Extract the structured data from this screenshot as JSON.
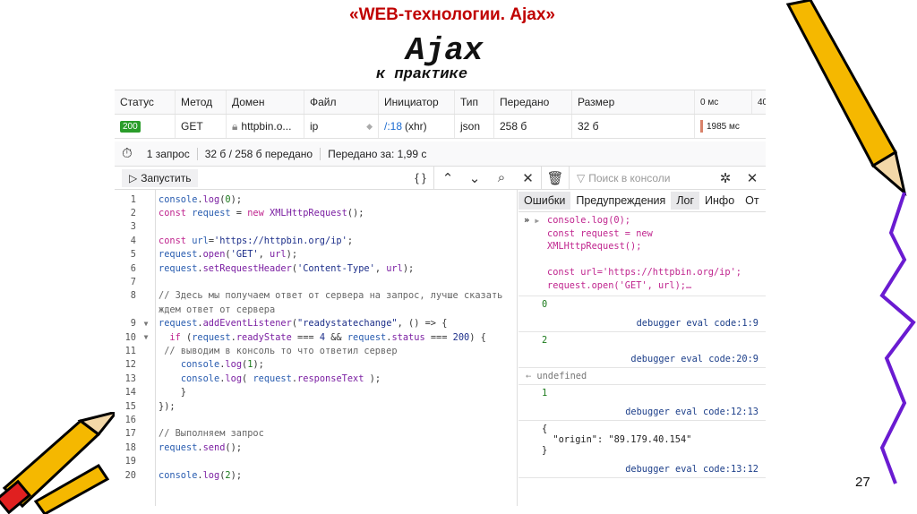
{
  "slide": {
    "title": "«WEB-технологии. Ajax»",
    "heading": "Ajax",
    "subheading": "к практике",
    "page_number": "27"
  },
  "network": {
    "headers": [
      "Статус",
      "Метод",
      "Домен",
      "Файл",
      "Инициатор",
      "Тип",
      "Передано",
      "Размер",
      "0 мс",
      "40"
    ],
    "row": {
      "status": "200",
      "method": "GET",
      "domain": "httpbin.o...",
      "file": "ip",
      "initiator_link": "/:18",
      "initiator_type": "(xhr)",
      "type": "json",
      "transferred": "258 б",
      "size": "32 б",
      "timing": "1985 мс"
    },
    "summary": {
      "requests": "1 запрос",
      "transferred": "32 б / 258 б передано",
      "time": "Передано за: 1,99 с"
    }
  },
  "editor": {
    "run_label": "Запустить",
    "pretty_label": "{ }",
    "lines": [
      {
        "n": "1",
        "t": [
          [
            "v",
            "console"
          ],
          [
            "o",
            "."
          ],
          [
            "f",
            "log"
          ],
          [
            "o",
            "("
          ],
          [
            "n",
            "0"
          ],
          [
            "o",
            ");"
          ]
        ]
      },
      {
        "n": "2",
        "t": [
          [
            "k",
            "const "
          ],
          [
            "v",
            "request"
          ],
          [
            "o",
            " = "
          ],
          [
            "k",
            "new "
          ],
          [
            "f",
            "XMLHttpRequest"
          ],
          [
            "o",
            "();"
          ]
        ]
      },
      {
        "n": "3",
        "t": []
      },
      {
        "n": "4",
        "t": [
          [
            "k",
            "const "
          ],
          [
            "v",
            "url"
          ],
          [
            "o",
            "="
          ],
          [
            "s",
            "'https://httpbin.org/ip'"
          ],
          [
            "o",
            ";"
          ]
        ]
      },
      {
        "n": "5",
        "t": [
          [
            "v",
            "request"
          ],
          [
            "o",
            "."
          ],
          [
            "f",
            "open"
          ],
          [
            "o",
            "("
          ],
          [
            "s",
            "'GET'"
          ],
          [
            "o",
            ", "
          ],
          [
            "f",
            "url"
          ],
          [
            "o",
            ");"
          ]
        ]
      },
      {
        "n": "6",
        "t": [
          [
            "v",
            "request"
          ],
          [
            "o",
            "."
          ],
          [
            "f",
            "setRequestHeader"
          ],
          [
            "o",
            "("
          ],
          [
            "s",
            "'Content-Type'"
          ],
          [
            "o",
            ", "
          ],
          [
            "f",
            "url"
          ],
          [
            "o",
            ");"
          ]
        ]
      },
      {
        "n": "7",
        "t": []
      },
      {
        "n": "8",
        "t": [
          [
            "m",
            "// Здесь мы получаем ответ от сервера на запрос, лучше сказать"
          ]
        ]
      },
      {
        "n": "",
        "t": [
          [
            "m",
            "ждем ответ от сервера"
          ]
        ]
      },
      {
        "n": "9",
        "fold": true,
        "t": [
          [
            "v",
            "request"
          ],
          [
            "o",
            "."
          ],
          [
            "f",
            "addEventListener"
          ],
          [
            "o",
            "("
          ],
          [
            "s",
            "\"readystatechange\""
          ],
          [
            "o",
            ", () => {"
          ]
        ]
      },
      {
        "n": "10",
        "fold": true,
        "t": [
          [
            "o",
            "  "
          ],
          [
            "k",
            "if "
          ],
          [
            "o",
            "("
          ],
          [
            "v",
            "request"
          ],
          [
            "o",
            "."
          ],
          [
            "f",
            "readyState"
          ],
          [
            "o",
            " === "
          ],
          [
            "s",
            "4"
          ],
          [
            "o",
            " && "
          ],
          [
            "v",
            "request"
          ],
          [
            "o",
            "."
          ],
          [
            "f",
            "status"
          ],
          [
            "o",
            " === "
          ],
          [
            "s",
            "200"
          ],
          [
            "o",
            ") {"
          ]
        ]
      },
      {
        "n": "11",
        "t": [
          [
            "m",
            " // выводим в консоль то что ответил сервер"
          ]
        ]
      },
      {
        "n": "12",
        "t": [
          [
            "o",
            "    "
          ],
          [
            "v",
            "console"
          ],
          [
            "o",
            "."
          ],
          [
            "f",
            "log"
          ],
          [
            "o",
            "("
          ],
          [
            "n",
            "1"
          ],
          [
            "o",
            ");"
          ]
        ]
      },
      {
        "n": "13",
        "t": [
          [
            "o",
            "    "
          ],
          [
            "v",
            "console"
          ],
          [
            "o",
            "."
          ],
          [
            "f",
            "log"
          ],
          [
            "o",
            "( "
          ],
          [
            "v",
            "request"
          ],
          [
            "o",
            "."
          ],
          [
            "f",
            "responseText"
          ],
          [
            "o",
            " );"
          ]
        ]
      },
      {
        "n": "14",
        "t": [
          [
            "o",
            "    }"
          ]
        ]
      },
      {
        "n": "15",
        "t": [
          [
            "o",
            "});"
          ]
        ]
      },
      {
        "n": "16",
        "t": []
      },
      {
        "n": "17",
        "t": [
          [
            "m",
            "// Выполняем запрос"
          ]
        ]
      },
      {
        "n": "18",
        "t": [
          [
            "v",
            "request"
          ],
          [
            "o",
            "."
          ],
          [
            "f",
            "send"
          ],
          [
            "o",
            "();"
          ]
        ]
      },
      {
        "n": "19",
        "t": []
      },
      {
        "n": "20",
        "t": [
          [
            "v",
            "console"
          ],
          [
            "o",
            "."
          ],
          [
            "f",
            "log"
          ],
          [
            "o",
            "("
          ],
          [
            "n",
            "2"
          ],
          [
            "o",
            ");"
          ]
        ]
      }
    ]
  },
  "console": {
    "filter_placeholder": "Поиск в консоли",
    "tabs": [
      "Ошибки",
      "Предупреждения",
      "Лог",
      "Инфо",
      "От"
    ],
    "input_lines": [
      "console.log(0);",
      "const request = new",
      "XMLHttpRequest();",
      "",
      "const url='https://httpbin.org/ip';",
      "request.open('GET', url);…"
    ],
    "entries": [
      {
        "value": "0",
        "location": "debugger eval code:1:9"
      },
      {
        "value": "2",
        "location": "debugger eval code:20:9"
      },
      {
        "value": "undefined",
        "result": true
      },
      {
        "value": "1",
        "location": "debugger eval code:12:13"
      },
      {
        "value": "{\n  \"origin\": \"89.179.40.154\"\n}",
        "location": "debugger eval code:13:12",
        "json": true
      }
    ]
  }
}
